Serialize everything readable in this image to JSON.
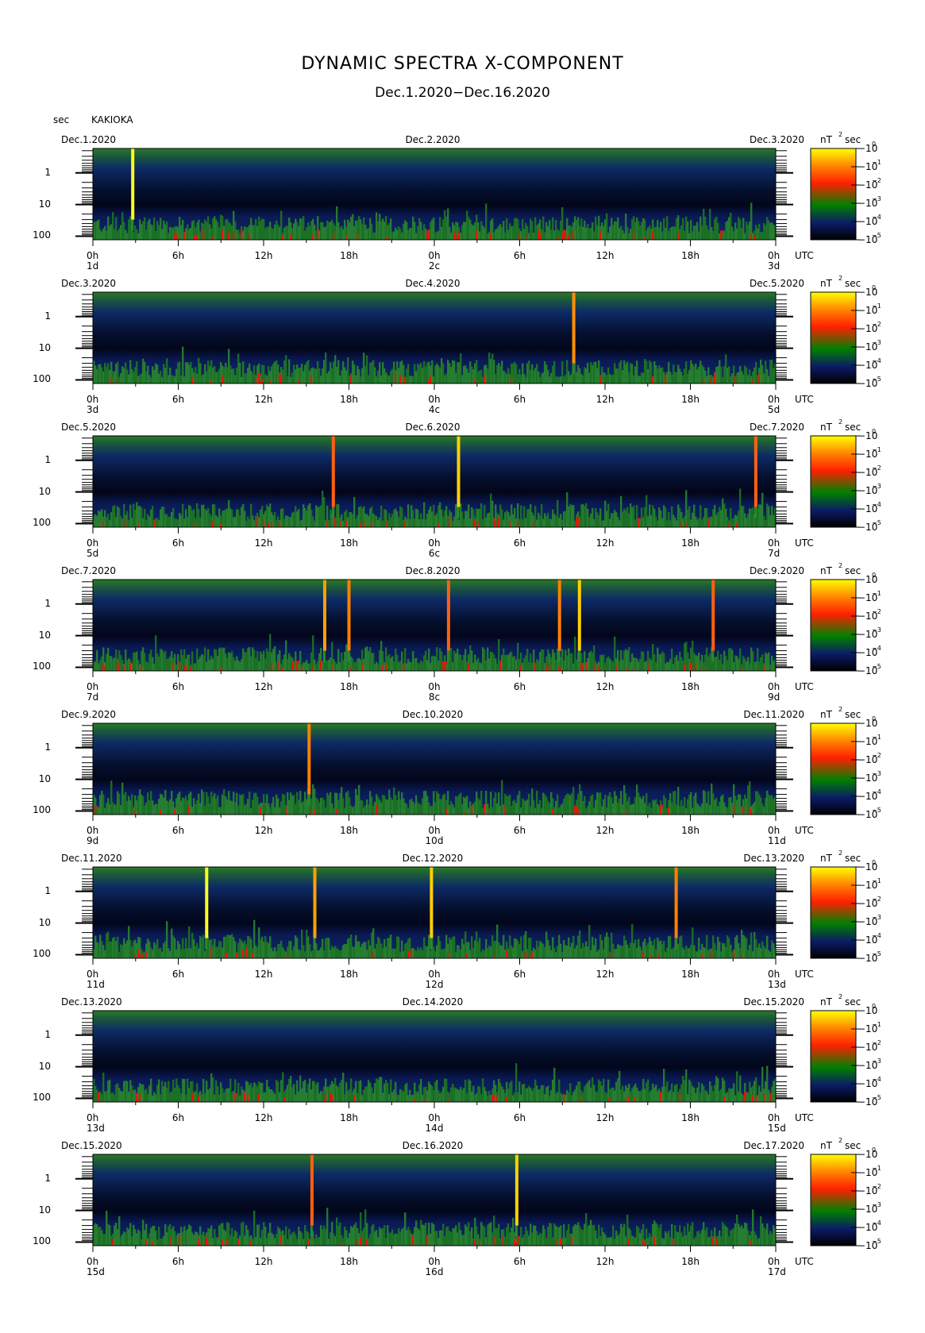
{
  "header": {
    "title": "DYNAMIC SPECTRA X-COMPONENT",
    "subtitle": "Dec.1.2020−Dec.16.2020",
    "period_unit": "sec",
    "station": "KAKIOKA"
  },
  "chart_data": {
    "type": "heatmap",
    "title": "DYNAMIC SPECTRA X-COMPONENT",
    "subtitle": "Dec.1.2020−Dec.16.2020",
    "station": "KAKIOKA",
    "ylabel": "sec",
    "y_axis_scale": "log",
    "y_ticks": [
      "1",
      "10",
      "100"
    ],
    "x_ticks": [
      "0h",
      "6h",
      "12h",
      "18h",
      "0h",
      "6h",
      "12h",
      "18h",
      "0h"
    ],
    "x_unit": "UTC",
    "colorbar": {
      "unit_label": "nT",
      "unit_exp": "2",
      "unit_suffix": "sec",
      "scale": "log",
      "base": "10",
      "exponents": [
        "0",
        "−1",
        "−2",
        "−3",
        "−4",
        "−5"
      ],
      "colors": [
        "#ffff00",
        "#ff8000",
        "#ff2000",
        "#008000",
        "#0b1a66",
        "#000000"
      ]
    },
    "panels": [
      {
        "date_left": "Dec.1.2020",
        "date_mid": "Dec.2.2020",
        "date_right": "Dec.3.2020",
        "day_labels": [
          "1d",
          "2c",
          "3d"
        ],
        "spikes": [
          {
            "hour": 2.8,
            "color": "#ffff20",
            "top": 0.0
          }
        ]
      },
      {
        "date_left": "Dec.3.2020",
        "date_mid": "Dec.4.2020",
        "date_right": "Dec.5.2020",
        "day_labels": [
          "3d",
          "4c",
          "5d"
        ],
        "spikes": [
          {
            "hour": 33.8,
            "color": "#ff9000",
            "top": 0.0
          }
        ]
      },
      {
        "date_left": "Dec.5.2020",
        "date_mid": "Dec.6.2020",
        "date_right": "Dec.7.2020",
        "day_labels": [
          "5d",
          "6c",
          "7d"
        ],
        "spikes": [
          {
            "hour": 16.9,
            "color": "#ff6010",
            "top": 0.0
          },
          {
            "hour": 25.7,
            "color": "#ffd000",
            "top": 0.0
          },
          {
            "hour": 46.6,
            "color": "#ff6010",
            "top": 0.0
          }
        ]
      },
      {
        "date_left": "Dec.7.2020",
        "date_mid": "Dec.8.2020",
        "date_right": "Dec.9.2020",
        "day_labels": [
          "7d",
          "8c",
          "9d"
        ],
        "spikes": [
          {
            "hour": 16.3,
            "color": "#ffa000",
            "top": 0.0
          },
          {
            "hour": 18.0,
            "color": "#ff8000",
            "top": 0.0
          },
          {
            "hour": 25.0,
            "color": "#ff6010",
            "top": 0.0
          },
          {
            "hour": 32.8,
            "color": "#ff8000",
            "top": 0.0
          },
          {
            "hour": 34.2,
            "color": "#ffd000",
            "top": 0.0
          },
          {
            "hour": 43.6,
            "color": "#ff6010",
            "top": 0.0
          }
        ]
      },
      {
        "date_left": "Dec.9.2020",
        "date_mid": "Dec.10.2020",
        "date_right": "Dec.11.2020",
        "day_labels": [
          "9d",
          "10d",
          "11d"
        ],
        "spikes": [
          {
            "hour": 15.2,
            "color": "#ff8000",
            "top": 0.0
          }
        ]
      },
      {
        "date_left": "Dec.11.2020",
        "date_mid": "Dec.12.2020",
        "date_right": "Dec.13.2020",
        "day_labels": [
          "11d",
          "12d",
          "13d"
        ],
        "spikes": [
          {
            "hour": 8.0,
            "color": "#ffff20",
            "top": 0.0
          },
          {
            "hour": 15.6,
            "color": "#ffa000",
            "top": 0.0
          },
          {
            "hour": 23.8,
            "color": "#ffd000",
            "top": 0.0
          },
          {
            "hour": 41.0,
            "color": "#ff8000",
            "top": 0.0
          }
        ]
      },
      {
        "date_left": "Dec.13.2020",
        "date_mid": "Dec.14.2020",
        "date_right": "Dec.15.2020",
        "day_labels": [
          "13d",
          "14d",
          "15d"
        ],
        "spikes": []
      },
      {
        "date_left": "Dec.15.2020",
        "date_mid": "Dec.16.2020",
        "date_right": "Dec.17.2020",
        "day_labels": [
          "15d",
          "16d",
          "17d"
        ],
        "spikes": [
          {
            "hour": 15.4,
            "color": "#ff6010",
            "top": 0.0
          },
          {
            "hour": 29.8,
            "color": "#ffd000",
            "top": 0.0
          }
        ]
      }
    ]
  }
}
